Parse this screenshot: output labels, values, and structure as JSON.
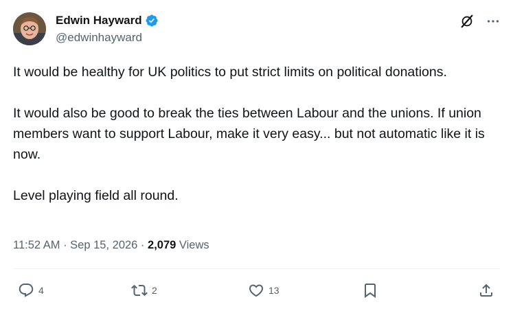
{
  "author": {
    "name": "Edwin Hayward",
    "handle": "@edwinhayward"
  },
  "tweet": {
    "paragraphs": [
      "It would be healthy for UK politics to put strict limits on political donations.",
      "It would also be good to break the ties between Labour and the unions. If union members want to support Labour, make it very easy... but not automatic like it is now.",
      "Level playing field all round."
    ]
  },
  "meta": {
    "time": "11:52 AM",
    "sep1": " · ",
    "date": "Sep 15, 2026",
    "sep2": " · ",
    "views_count": "2,079",
    "views_label": " Views"
  },
  "actions": {
    "reply_count": "4",
    "repost_count": "2",
    "like_count": "13"
  },
  "icons": {
    "verified": "verified-badge-icon",
    "grok": "grok-icon",
    "more": "more-icon",
    "reply": "reply-icon",
    "repost": "repost-icon",
    "like": "like-icon",
    "bookmark": "bookmark-icon",
    "share": "share-icon"
  },
  "colors": {
    "verified": "#1d9bf0",
    "secondary_text": "#536471",
    "primary_text": "#0f1419"
  }
}
